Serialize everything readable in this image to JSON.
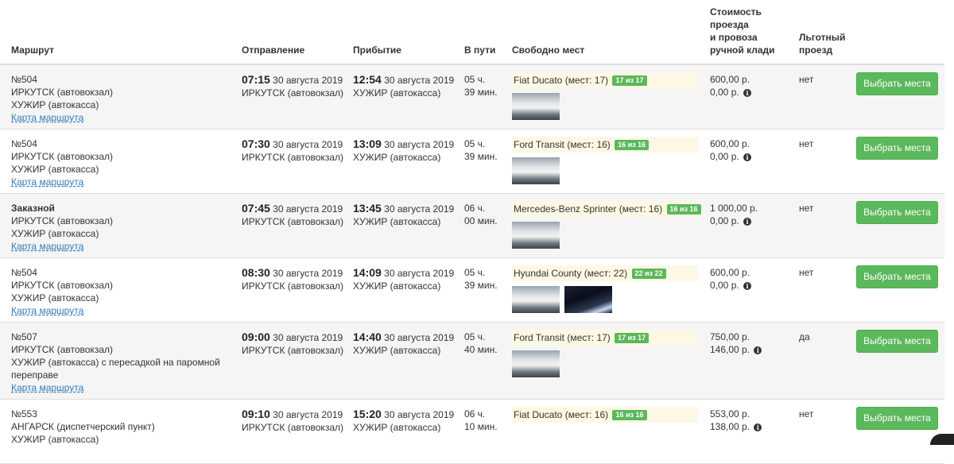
{
  "headers": {
    "route": "Маршрут",
    "departure": "Отправление",
    "arrival": "Прибытие",
    "duration": "В пути",
    "seats": "Свободно мест",
    "price_l1": "Стоимость",
    "price_l2": "проезда",
    "price_l3": "и провоза",
    "price_l4": "ручной клади",
    "benefit_l1": "Льготный",
    "benefit_l2": "проезд"
  },
  "rows": [
    {
      "route_name": "№504",
      "route_from": "ИРКУТСК (автовокзал)",
      "route_to": "ХУЖИР (автокасса)",
      "map_link": "Карта маршрута",
      "dep_time": "07:15",
      "dep_date": "30 августа 2019",
      "dep_place": "ИРКУТСК (автовокзал)",
      "arr_time": "12:54",
      "arr_date": "30 августа 2019",
      "arr_place": "ХУЖИР (автокасса)",
      "dur_h": "05 ч.",
      "dur_m": "39 мин.",
      "vehicle": "Fiat Ducato (мест: 17)",
      "badge": "17 из 17",
      "price_fare": "600,00 р.",
      "price_bag": "0,00 р.",
      "benefit": "нет",
      "button": "Выбрать места"
    },
    {
      "route_name": "№504",
      "route_from": "ИРКУТСК (автовокзал)",
      "route_to": "ХУЖИР (автокасса)",
      "map_link": "Карта маршрута",
      "dep_time": "07:30",
      "dep_date": "30 августа 2019",
      "dep_place": "ИРКУТСК (автовокзал)",
      "arr_time": "13:09",
      "arr_date": "30 августа 2019",
      "arr_place": "ХУЖИР (автокасса)",
      "dur_h": "05 ч.",
      "dur_m": "39 мин.",
      "vehicle": "Ford Transit (мест: 16)",
      "badge": "16 из 16",
      "price_fare": "600,00 р.",
      "price_bag": "0,00 р.",
      "benefit": "нет",
      "button": "Выбрать места"
    },
    {
      "route_name": "Заказной",
      "route_from": "ИРКУТСК (автовокзал)",
      "route_to": "ХУЖИР (автокасса)",
      "map_link": "Карта маршрута",
      "dep_time": "07:45",
      "dep_date": "30 августа 2019",
      "dep_place": "ИРКУТСК (автовокзал)",
      "arr_time": "13:45",
      "arr_date": "30 августа 2019",
      "arr_place": "ХУЖИР (автокасса)",
      "dur_h": "06 ч.",
      "dur_m": "00 мин.",
      "vehicle": "Mercedes-Benz Sprinter (мест: 16)",
      "badge": "16 из 16",
      "price_fare": "1 000,00 р.",
      "price_bag": "0,00 р.",
      "benefit": "нет",
      "button": "Выбрать места"
    },
    {
      "route_name": "№504",
      "route_from": "ИРКУТСК (автовокзал)",
      "route_to": "ХУЖИР (автокасса)",
      "map_link": "Карта маршрута",
      "dep_time": "08:30",
      "dep_date": "30 августа 2019",
      "dep_place": "ИРКУТСК (автовокзал)",
      "arr_time": "14:09",
      "arr_date": "30 августа 2019",
      "arr_place": "ХУЖИР (автокасса)",
      "dur_h": "05 ч.",
      "dur_m": "39 мин.",
      "vehicle": "Hyundai County (мест: 22)",
      "badge": "22 из 22",
      "price_fare": "600,00 р.",
      "price_bag": "0,00 р.",
      "benefit": "нет",
      "button": "Выбрать места"
    },
    {
      "route_name": "№507",
      "route_from": "ИРКУТСК (автовокзал)",
      "route_to": "ХУЖИР (автокасса) с пересадкой на паромной",
      "route_to2": "переправе",
      "map_link": "Карта маршрута",
      "dep_time": "09:00",
      "dep_date": "30 августа 2019",
      "dep_place": "ИРКУТСК (автовокзал)",
      "arr_time": "14:40",
      "arr_date": "30 августа 2019",
      "arr_place": "ХУЖИР (автокасса)",
      "dur_h": "05 ч.",
      "dur_m": "40 мин.",
      "vehicle": "Ford Transit (мест: 17)",
      "badge": "17 из 17",
      "price_fare": "750,00 р.",
      "price_bag": "146,00 р.",
      "benefit": "да",
      "button": "Выбрать места"
    },
    {
      "route_name": "№553",
      "route_from": "АНГАРСК (диспетчерский пункт)",
      "route_to": "ХУЖИР (автокасса)",
      "dep_time": "09:10",
      "dep_date": "30 августа 2019",
      "dep_place": "ИРКУТСК (автовокзал)",
      "arr_time": "15:20",
      "arr_date": "30 августа 2019",
      "arr_place": "ХУЖИР (автокасса)",
      "dur_h": "06 ч.",
      "dur_m": "10 мин.",
      "vehicle": "Fiat Ducato (мест: 16)",
      "badge": "16 из 16",
      "price_fare": "553,00 р.",
      "price_bag": "138,00 р.",
      "benefit": "нет",
      "button": "Выбрать места"
    }
  ]
}
